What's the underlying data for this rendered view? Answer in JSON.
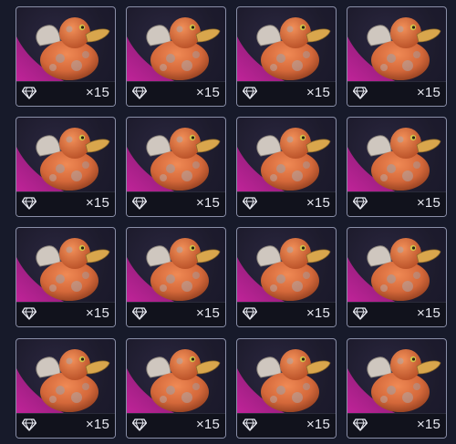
{
  "inventory": {
    "items": [
      {
        "item": "rubber-duck",
        "rarity_color": "#c2249a",
        "currency_icon": "diamond-icon",
        "quantity": "×15"
      },
      {
        "item": "rubber-duck",
        "rarity_color": "#c2249a",
        "currency_icon": "diamond-icon",
        "quantity": "×15"
      },
      {
        "item": "rubber-duck",
        "rarity_color": "#c2249a",
        "currency_icon": "diamond-icon",
        "quantity": "×15"
      },
      {
        "item": "rubber-duck",
        "rarity_color": "#c2249a",
        "currency_icon": "diamond-icon",
        "quantity": "×15"
      },
      {
        "item": "rubber-duck",
        "rarity_color": "#c2249a",
        "currency_icon": "diamond-icon",
        "quantity": "×15"
      },
      {
        "item": "rubber-duck",
        "rarity_color": "#c2249a",
        "currency_icon": "diamond-icon",
        "quantity": "×15"
      },
      {
        "item": "rubber-duck",
        "rarity_color": "#c2249a",
        "currency_icon": "diamond-icon",
        "quantity": "×15"
      },
      {
        "item": "rubber-duck",
        "rarity_color": "#c2249a",
        "currency_icon": "diamond-icon",
        "quantity": "×15"
      },
      {
        "item": "rubber-duck",
        "rarity_color": "#c2249a",
        "currency_icon": "diamond-icon",
        "quantity": "×15"
      },
      {
        "item": "rubber-duck",
        "rarity_color": "#c2249a",
        "currency_icon": "diamond-icon",
        "quantity": "×15"
      },
      {
        "item": "rubber-duck",
        "rarity_color": "#c2249a",
        "currency_icon": "diamond-icon",
        "quantity": "×15"
      },
      {
        "item": "rubber-duck",
        "rarity_color": "#c2249a",
        "currency_icon": "diamond-icon",
        "quantity": "×15"
      },
      {
        "item": "rubber-duck",
        "rarity_color": "#c2249a",
        "currency_icon": "diamond-icon",
        "quantity": "×15"
      },
      {
        "item": "rubber-duck",
        "rarity_color": "#c2249a",
        "currency_icon": "diamond-icon",
        "quantity": "×15"
      },
      {
        "item": "rubber-duck",
        "rarity_color": "#c2249a",
        "currency_icon": "diamond-icon",
        "quantity": "×15"
      },
      {
        "item": "rubber-duck",
        "rarity_color": "#c2249a",
        "currency_icon": "diamond-icon",
        "quantity": "×15"
      }
    ]
  },
  "colors": {
    "background": "#171a2a",
    "card_border": "#8a8fa8",
    "footer": "#11121c",
    "duck_body": "#d4683a",
    "duck_beak": "#d9a64c",
    "duck_wing": "#cfc7bf"
  }
}
